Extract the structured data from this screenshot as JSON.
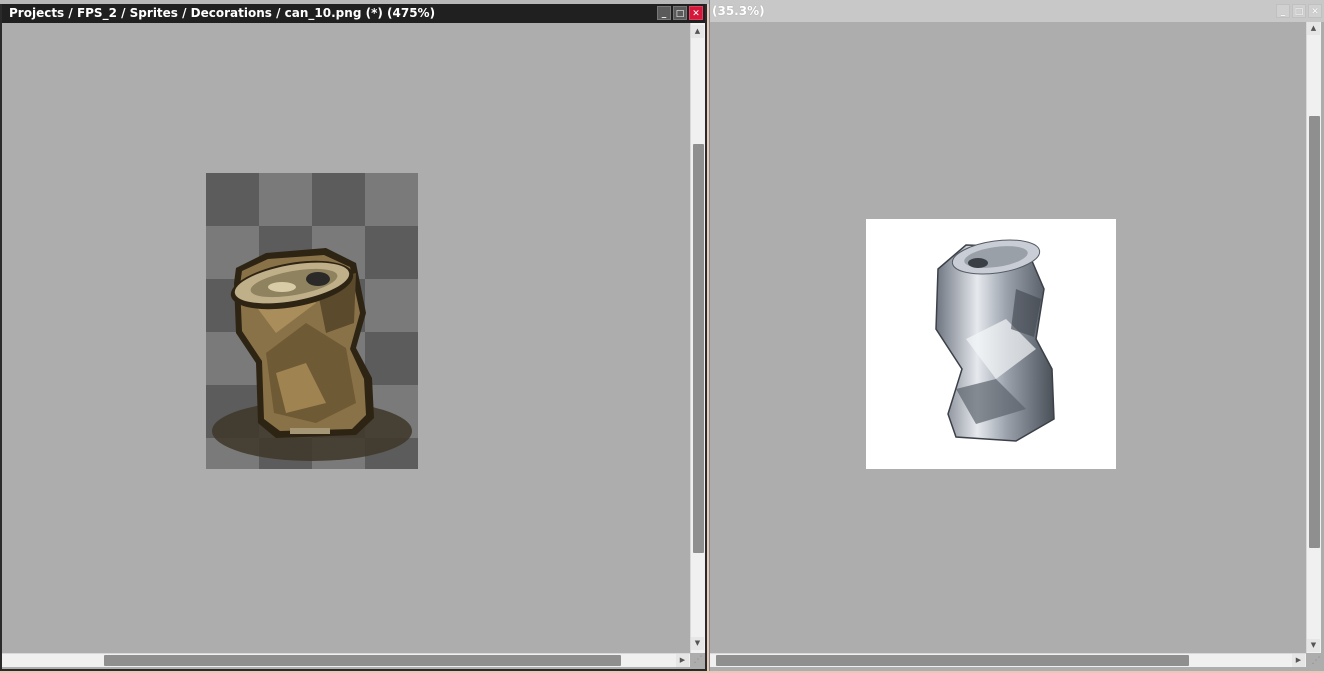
{
  "left_window": {
    "title": "Projects / FPS_2 / Sprites / Decorations / can_10.png (*) (475%)",
    "buttons": {
      "minimize": "_",
      "maximize": "□",
      "close": "✕"
    }
  },
  "right_window": {
    "title": "(35.3%)",
    "buttons": {
      "minimize": "_",
      "maximize": "□",
      "close": "✕"
    }
  },
  "scroll": {
    "up": "▲",
    "down": "▼",
    "left": "◀",
    "right": "▶",
    "grip": "⋰"
  },
  "colors": {
    "canvas_bg": "#adadad",
    "checker_dark": "#5c5c5c",
    "checker_light": "#7a7a7a",
    "close_red": "#d5173a"
  }
}
